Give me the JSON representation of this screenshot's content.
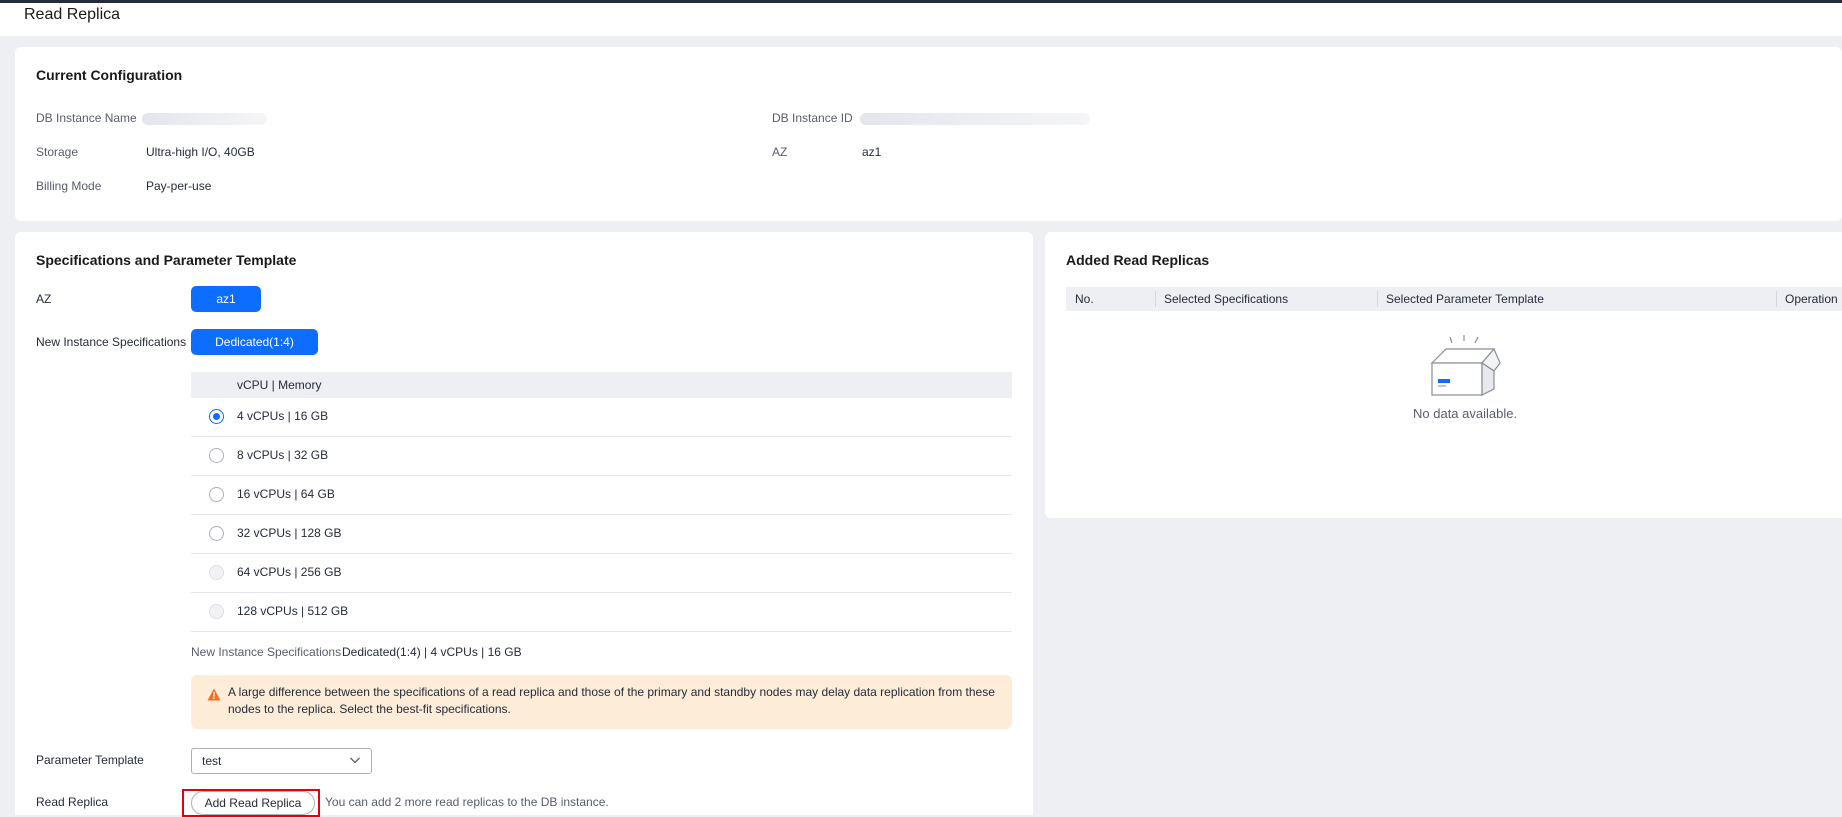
{
  "page": {
    "title": "Read Replica"
  },
  "current_config": {
    "title": "Current Configuration",
    "fields": {
      "db_instance_name_label": "DB Instance Name",
      "db_instance_id_label": "DB Instance ID",
      "storage_label": "Storage",
      "storage_value": "Ultra-high I/O, 40GB",
      "az_label": "AZ",
      "az_value": "az1",
      "billing_label": "Billing Mode",
      "billing_value": "Pay-per-use"
    }
  },
  "spec_section": {
    "title": "Specifications and Parameter Template",
    "az_label": "AZ",
    "az_button": "az1",
    "new_spec_label": "New Instance Specifications",
    "spec_type_button": "Dedicated(1:4)",
    "table_header": "vCPU | Memory",
    "options": [
      {
        "label": "4 vCPUs | 16 GB",
        "state": "selected"
      },
      {
        "label": "8 vCPUs | 32 GB",
        "state": "enabled"
      },
      {
        "label": "16 vCPUs | 64 GB",
        "state": "enabled"
      },
      {
        "label": "32 vCPUs | 128 GB",
        "state": "enabled"
      },
      {
        "label": "64 vCPUs | 256 GB",
        "state": "disabled"
      },
      {
        "label": "128 vCPUs | 512 GB",
        "state": "disabled"
      }
    ],
    "summary_label": "New Instance Specifications",
    "summary_value": "Dedicated(1:4) | 4 vCPUs | 16 GB",
    "warning": "A large difference between the specifications of a read replica and those of the primary and standby nodes may delay data replication from these nodes to the replica. Select the best-fit specifications.",
    "param_template_label": "Parameter Template",
    "param_template_value": "test",
    "read_replica_label": "Read Replica",
    "add_button": "Add Read Replica",
    "hint": "You can add 2 more read replicas to the DB instance."
  },
  "added_replicas": {
    "title": "Added Read Replicas",
    "columns": [
      "No.",
      "Selected Specifications",
      "Selected Parameter Template",
      "Operation"
    ],
    "empty_text": "No data available."
  },
  "colors": {
    "accent": "#0d6dfe",
    "warning_bg": "#fdecd8",
    "warning_icon": "#f66f1a",
    "highlight": "#e5000d"
  },
  "icons": [
    "warning-icon",
    "chevron-down-icon",
    "empty-box-icon"
  ]
}
